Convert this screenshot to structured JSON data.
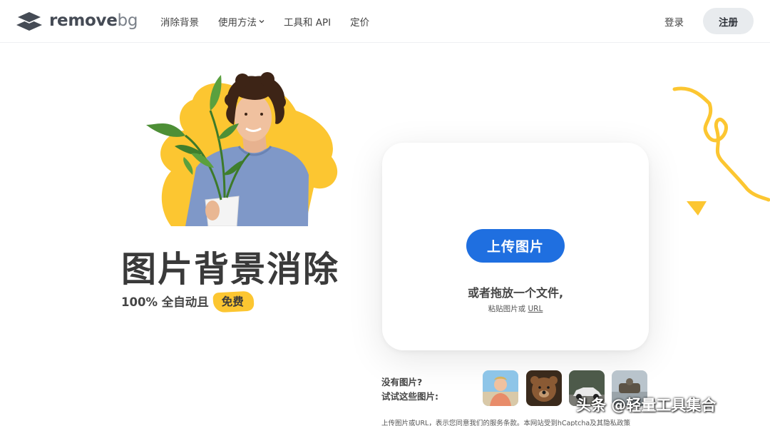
{
  "header": {
    "logo": {
      "name": "remove",
      "suffix": "bg"
    },
    "nav": [
      {
        "label": "消除背景"
      },
      {
        "label": "使用方法"
      },
      {
        "label": "工具和 API"
      },
      {
        "label": "定价"
      }
    ],
    "login_label": "登录",
    "signup_label": "注册"
  },
  "hero": {
    "headline": "图片背景消除",
    "subline": "100% 全自动且",
    "badge": "免费"
  },
  "upload": {
    "button_label": "上传图片",
    "drop_text": "或者拖放一个文件,",
    "paste_prefix": "粘贴图片或 ",
    "paste_link": "URL"
  },
  "samples": {
    "line1": "没有图片?",
    "line2": "试试这些图片:",
    "thumbs": [
      {
        "icon": "person-thumbnail"
      },
      {
        "icon": "bear-thumbnail"
      },
      {
        "icon": "car-thumbnail"
      },
      {
        "icon": "gadget-thumbnail"
      }
    ]
  },
  "terms": {
    "text1": "上传图片或URL，表示您同意我们的",
    "link1": "服务条款",
    "text2": "。本网站受到hCaptcha及其",
    "link2": "隐私政策"
  },
  "watermark": "头条 @轻量工具集合",
  "colors": {
    "accent": "#1f6fe0",
    "yellow": "#fcc631",
    "text": "#454545"
  }
}
